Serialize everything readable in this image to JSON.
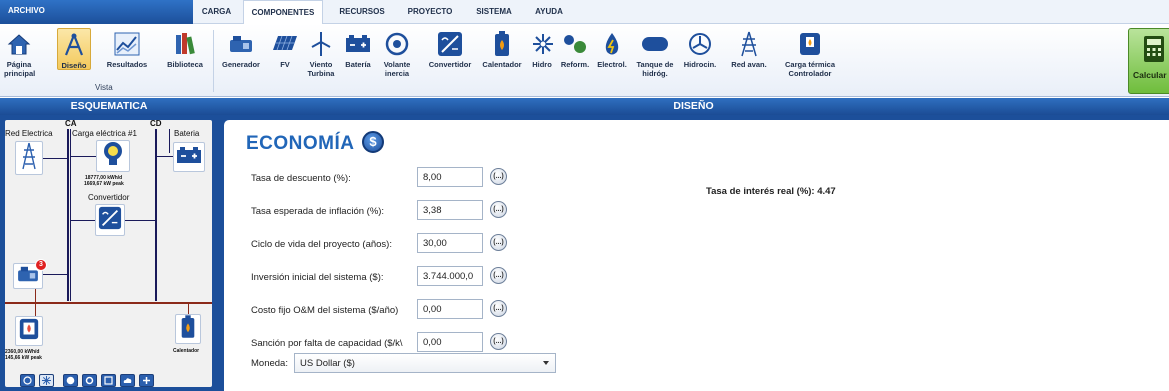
{
  "menu": {
    "archivo": "ARCHIVO",
    "tabs": [
      {
        "label": "CARGA"
      },
      {
        "label": "COMPONENTES"
      },
      {
        "label": "RECURSOS"
      },
      {
        "label": "PROYECTO"
      },
      {
        "label": "SISTEMA"
      },
      {
        "label": "AYUDA"
      }
    ],
    "active_tab": "COMPONENTES"
  },
  "ribbon": {
    "view_buttons": [
      {
        "label": "Página principal",
        "icon": "home-icon"
      },
      {
        "label": "Diseño",
        "icon": "compass-icon"
      },
      {
        "label": "Resultados",
        "icon": "chart-icon"
      },
      {
        "label": "Biblioteca",
        "icon": "library-icon"
      }
    ],
    "view_group_label": "Vista",
    "component_buttons": [
      {
        "label": "Generador",
        "icon": "generator-icon"
      },
      {
        "label": "FV",
        "icon": "solar-panel-icon"
      },
      {
        "label": "Viento Turbina",
        "icon": "wind-turbine-icon"
      },
      {
        "label": "Batería",
        "icon": "battery-icon"
      },
      {
        "label": "Volante inercia",
        "icon": "flywheel-icon"
      },
      {
        "label": "Convertidor",
        "icon": "converter-icon"
      },
      {
        "label": "Calentador",
        "icon": "heater-icon"
      },
      {
        "label": "Hidro",
        "icon": "hydro-icon"
      },
      {
        "label": "Reform.",
        "icon": "reformer-icon"
      },
      {
        "label": "Electrol.",
        "icon": "electrolyzer-icon"
      },
      {
        "label": "Tanque de hidróg.",
        "icon": "hydrogen-tank-icon"
      },
      {
        "label": "Hidrocin.",
        "icon": "hydrokinetic-icon"
      },
      {
        "label": "Red avan.",
        "icon": "advanced-grid-icon"
      },
      {
        "label": "Carga térmica Controlador",
        "icon": "thermal-load-controller-icon"
      }
    ],
    "calculate_label": "Calcular"
  },
  "schematic": {
    "header": "ESQUEMATICA",
    "bus_ac": "CA",
    "bus_dc": "CD",
    "grid_label": "Red Electrica",
    "load_label": "Carga eléctrica #1",
    "load_stats": [
      "18777,00 kWh/d",
      "1669,67 kW peak"
    ],
    "battery_label": "Bateria",
    "converter_label": "Convertidor",
    "generator_badge": "3",
    "thermal_stats": [
      "2360,00 kWh/d",
      "145,66 kW peak"
    ],
    "heater_label": "Calentador",
    "colors": {
      "panel": "#1c4f9a",
      "ac_bus": "#1a1a5a",
      "thermal_bus": "#8b2a1a",
      "badge": "#e02020"
    }
  },
  "design": {
    "header": "DISEÑO",
    "title": "ECONOMÍA",
    "dollar_symbol": "$",
    "fields": [
      {
        "label": "Tasa de descuento (%):",
        "value": "8,00",
        "edit": "(...)"
      },
      {
        "label": "Tasa esperada de inflación (%):",
        "value": "3,38",
        "edit": "(...)"
      },
      {
        "label": "Ciclo de vida del proyecto (años):",
        "value": "30,00",
        "edit": "(...)"
      },
      {
        "label": "Inversión inicial del sistema ($):",
        "value": "3.744.000,0",
        "edit": "(...)"
      },
      {
        "label": "Costo fijo O&M del sistema ($/año)",
        "value": "0,00",
        "edit": "(...)"
      },
      {
        "label": "Sanción por falta de capacidad ($/k\\",
        "value": "0,00",
        "edit": "(...)"
      }
    ],
    "currency_label": "Moneda:",
    "currency_value": "US Dollar ($)",
    "real_rate": "Tasa de interés real (%): 4.47",
    "colors": {
      "title": "#2166b8",
      "accent": "#1c4f9a"
    }
  }
}
